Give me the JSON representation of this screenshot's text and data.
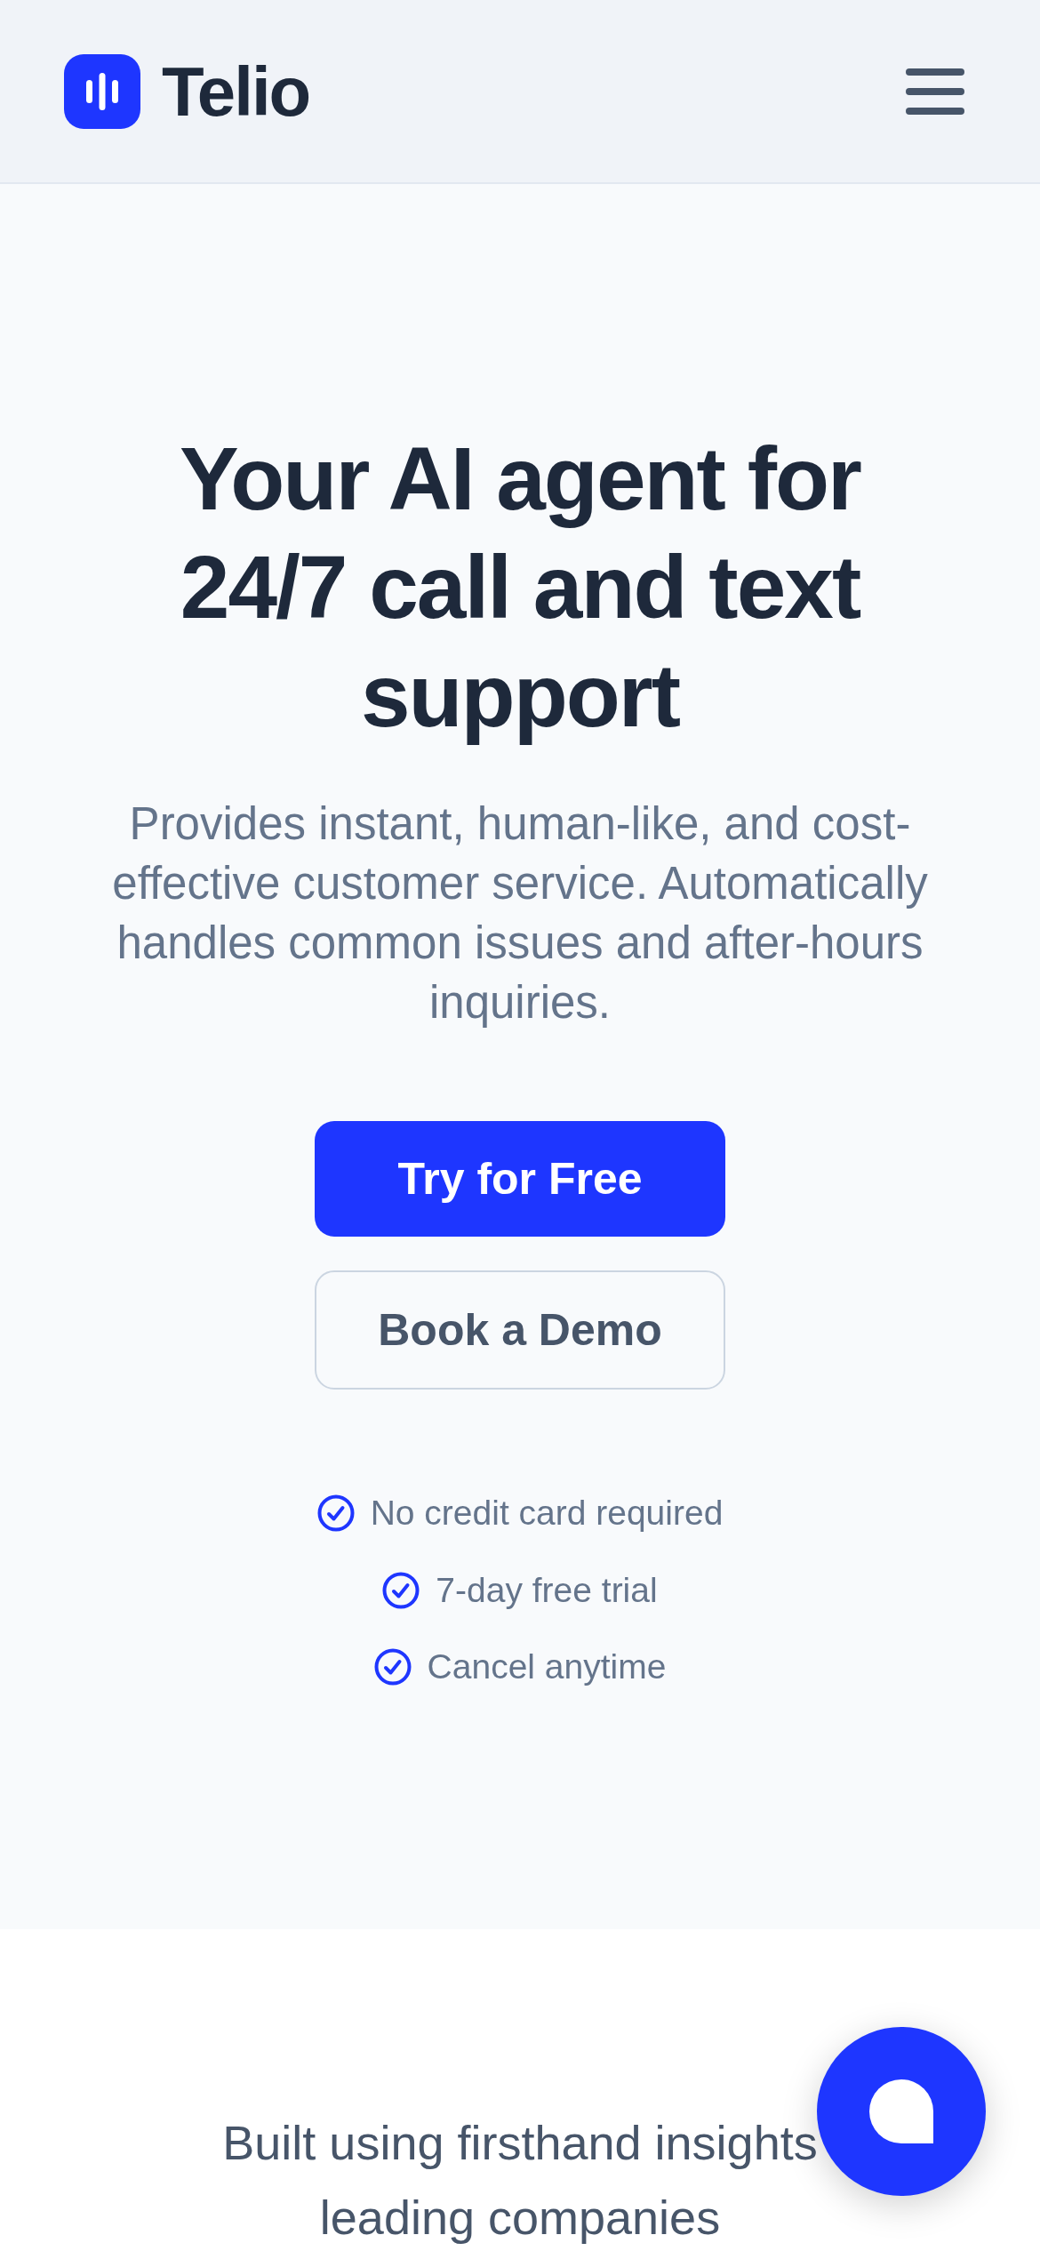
{
  "header": {
    "brand": "Telio"
  },
  "hero": {
    "title": "Your AI agent for 24/7 call and text support",
    "subtitle": "Provides instant, human-like, and cost-effective customer service. Automatically handles common issues and after-hours inquiries.",
    "buttons": [
      {
        "label": "Try for Free",
        "kind": "primary"
      },
      {
        "label": "Book a Demo",
        "kind": "secondary"
      }
    ],
    "features": [
      "No credit card required",
      "7-day free trial",
      "Cancel anytime"
    ]
  },
  "section": {
    "heading": "Built using firsthand insights leading companies"
  }
}
